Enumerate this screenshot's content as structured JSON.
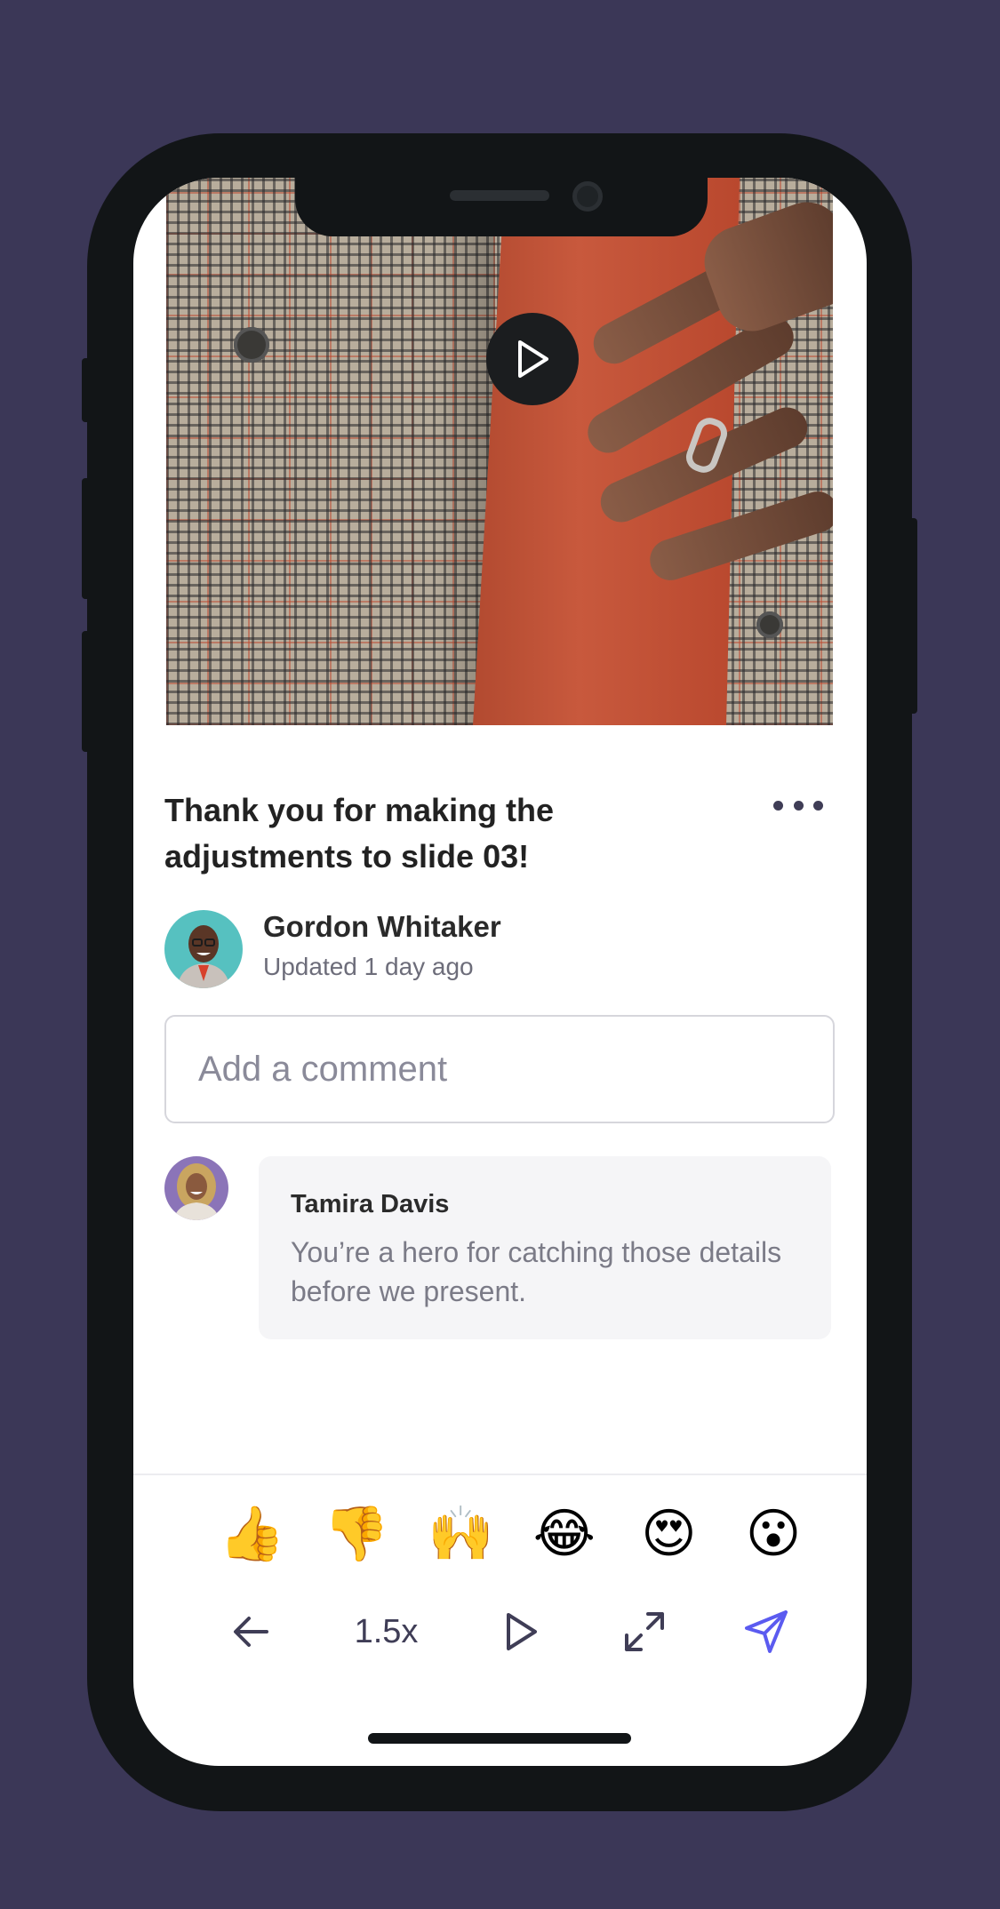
{
  "post": {
    "title": "Thank you for making the adjustments to slide 03!",
    "author": "Gordon Whitaker",
    "updated": "Updated 1 day ago"
  },
  "comment_input": {
    "placeholder": "Add a comment",
    "value": ""
  },
  "comments": [
    {
      "author": "Tamira Davis",
      "text": "You’re a hero for catching those details before we present."
    }
  ],
  "reactions": [
    {
      "icon": "thumbs-up-icon",
      "glyph": "👍"
    },
    {
      "icon": "thumbs-down-icon",
      "glyph": "👎"
    },
    {
      "icon": "raised-hands-icon",
      "glyph": "🙌"
    },
    {
      "icon": "tears-of-joy-icon",
      "glyph": "😂"
    },
    {
      "icon": "heart-eyes-icon",
      "glyph": "😍"
    },
    {
      "icon": "surprised-face-icon",
      "glyph": "😮"
    }
  ],
  "controls": {
    "speed": "1.5x",
    "icons": [
      "back-arrow-icon",
      "play-icon",
      "expand-icon",
      "send-icon"
    ]
  },
  "colors": {
    "background": "#3b3757",
    "accent": "#5b5bf0",
    "icon": "#3f3d56"
  }
}
